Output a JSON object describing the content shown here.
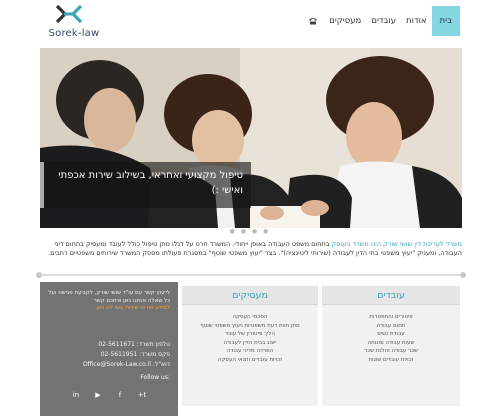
{
  "brand": {
    "logo_text": "Sorek-law"
  },
  "nav": {
    "home": "בית",
    "about": "אודות",
    "employees": "עובדים",
    "employers": "מעסיקים",
    "phone_icon": "phone-icon"
  },
  "hero": {
    "caption": "טיפול מקצועי ואחראי, בשילוב שירות אכפתי ואישי :)"
  },
  "intro": {
    "highlight": "משרד לעריכת דין שושי שורק הינו משרד העוסק",
    "text": " בתחום משפט העבודה באופן ייחודי. המשרד חרט על דגלו מתן טיפול כולל לעובד ומעסיק בתחום דיני העבודה, ומעניק \"יעוץ משפטי בתי הדין לעבודה (שירותי ליטיגציה)\". בצד \"יעוץ משפטי שוטף\" במסגרת פעולתו מספק המשרד שירותים משפטיים רחבים."
  },
  "contact": {
    "text": "לייעוץ קשר עם עו\"ד שושי שורק, לקביעת פגישה ועל כל שאלה אנחנו כאן איתכם קשר",
    "cta": "למידע אודות שירות עשו לנו כאן",
    "phone": "טלפון משרד: 02-5611671",
    "fax": "פקס משרד: 02-5611951",
    "email": "דוא\"ל: Office@Sorek-Law.co.il",
    "follow": "Follow us:"
  },
  "socials": [
    "in",
    "▶",
    "f",
    "+t"
  ],
  "boxes": {
    "employers": {
      "title": "מעסיקים",
      "items": [
        "הסכמי העסקה",
        "מתן חוות דעת משפטיות ויעוץ משפטי שוטף",
        "הליך פיטורין של עובד",
        "ייצוג בבית הדין לעבודה",
        "הפרדה מדיני עבודה",
        "זכויות עובדים ותנאי העסקה"
      ]
    },
    "employees": {
      "title": "עובדים",
      "items": [
        "פיטורים והתפטרות",
        "תחום עבודה",
        "עבודת נשים",
        "שעות עבודה ומנוחה",
        "שכר עבודה והלנת שכר",
        "זכויות עובדים שונות"
      ]
    }
  },
  "colors": {
    "accent": "#84d6e3",
    "link": "#36a3b8",
    "contact_bg": "#737373",
    "cta": "#f2a23c"
  }
}
